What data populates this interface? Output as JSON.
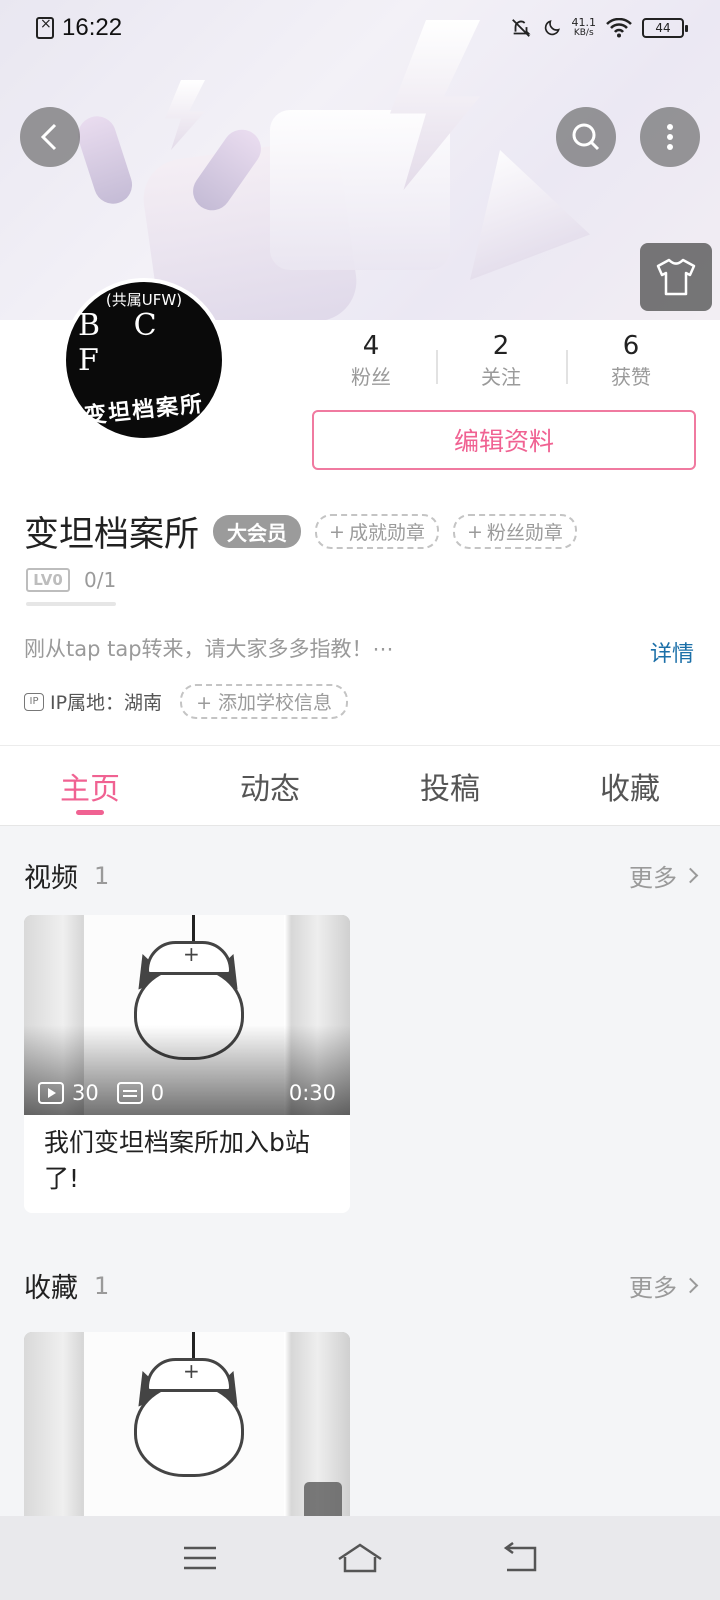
{
  "status_bar": {
    "time": "16:22",
    "net_speed_value": "41.1",
    "net_speed_unit": "KB/s",
    "battery": "44"
  },
  "icons": {
    "back": "back-arrow-icon",
    "search": "search-icon",
    "more": "more-vertical-icon",
    "outfit": "tshirt-icon"
  },
  "profile": {
    "avatar": {
      "line1": "(共属UFW)",
      "line2": "B C F",
      "line3": "变坦档案所"
    },
    "stats": [
      {
        "value": "4",
        "label": "粉丝"
      },
      {
        "value": "2",
        "label": "关注"
      },
      {
        "value": "6",
        "label": "获赞"
      }
    ],
    "edit_label": "编辑资料",
    "name": "变坦档案所",
    "vip_label": "大会员",
    "achievement_medal": "成就勋章",
    "fan_medal": "粉丝勋章",
    "level_badge": "LV0",
    "level_progress": "0/1",
    "bio": "刚从tap tap转来，请大家多多指教！⋯",
    "detail_label": "详情",
    "ip_badge": "IP",
    "ip_location": "IP属地：湖南",
    "add_school": "添加学校信息"
  },
  "tabs": [
    {
      "label": "主页",
      "active": true
    },
    {
      "label": "动态",
      "active": false
    },
    {
      "label": "投稿",
      "active": false
    },
    {
      "label": "收藏",
      "active": false
    }
  ],
  "sections": {
    "videos": {
      "title": "视频",
      "count": "1",
      "more": "更多",
      "items": [
        {
          "title": "我们变坦档案所加入b站了!",
          "plays": "30",
          "danmaku": "0",
          "duration": "0:30"
        }
      ]
    },
    "favorites": {
      "title": "收藏",
      "count": "1",
      "more": "更多"
    }
  },
  "colors": {
    "accent": "#f06292",
    "link": "#1b6fa8"
  }
}
